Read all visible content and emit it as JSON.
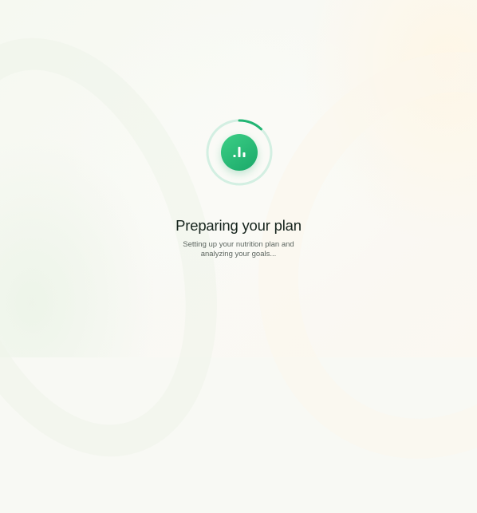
{
  "loader": {
    "progress": 0.12,
    "track_color": "#cfeee0",
    "arc_color": "#22b573",
    "logo_icon": "bar-chart-icon",
    "logo_color": "#22b573"
  },
  "status": {
    "title": "Preparing your plan",
    "subtitle_line1": "Setting up your nutrition plan and",
    "subtitle_line2": "analyzing your goals..."
  }
}
